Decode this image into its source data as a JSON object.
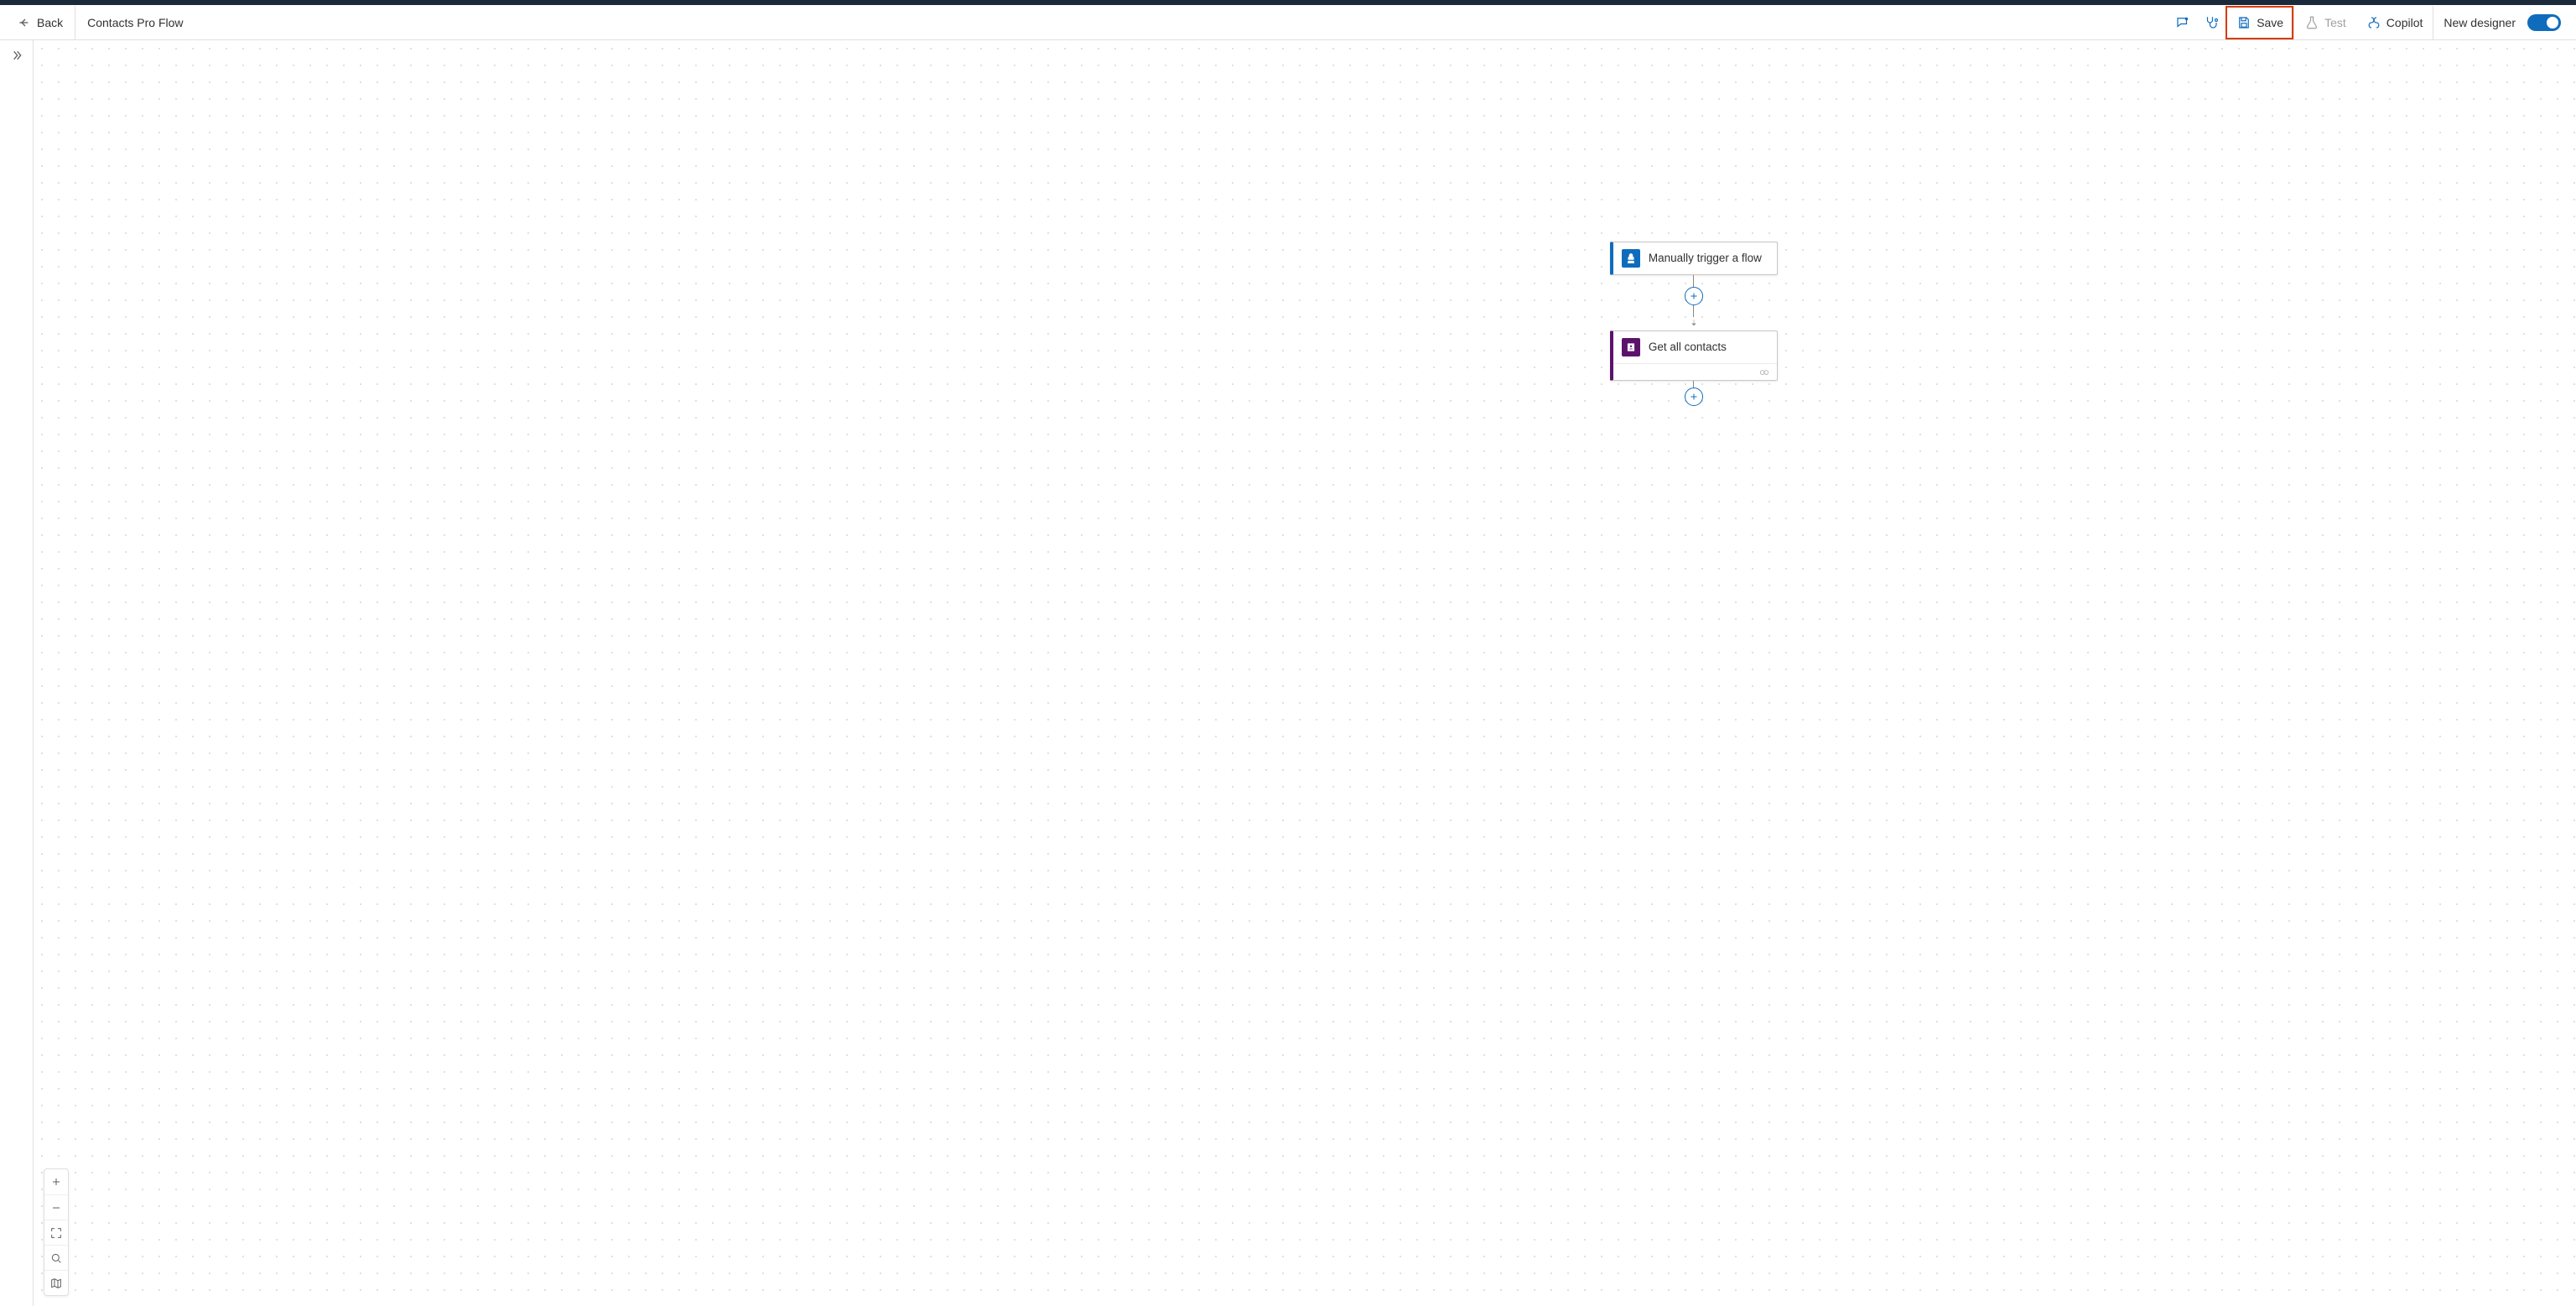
{
  "header": {
    "back_label": "Back",
    "flow_title": "Contacts Pro Flow",
    "save_label": "Save",
    "test_label": "Test",
    "copilot_label": "Copilot",
    "new_designer_label": "New designer"
  },
  "flow": {
    "trigger": {
      "label": "Manually trigger a flow"
    },
    "actions": [
      {
        "label": "Get all contacts"
      }
    ]
  }
}
